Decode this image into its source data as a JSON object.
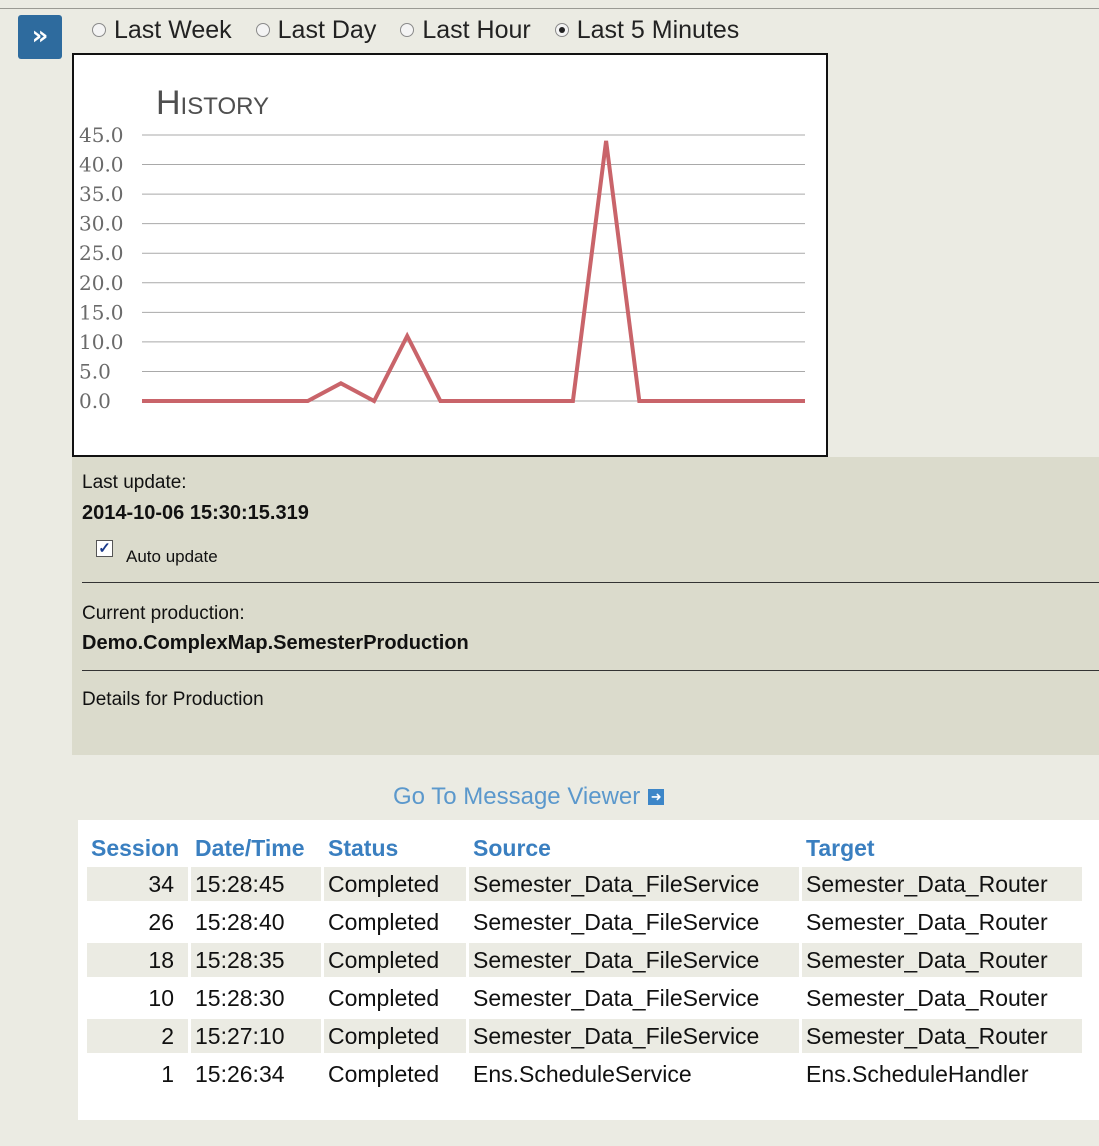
{
  "expand_button": {
    "label": "»"
  },
  "time_range": {
    "options": [
      {
        "label": "Last Week",
        "selected": false
      },
      {
        "label": "Last Day",
        "selected": false
      },
      {
        "label": "Last Hour",
        "selected": false
      },
      {
        "label": "Last 5 Minutes",
        "selected": true
      }
    ]
  },
  "chart_data": {
    "type": "line",
    "title": "History",
    "xlabel": "",
    "ylabel": "",
    "ylim": [
      0,
      45
    ],
    "yticks": [
      "45.0",
      "40.0",
      "35.0",
      "30.0",
      "25.0",
      "20.0",
      "15.0",
      "10.0",
      "5.0",
      "0.0"
    ],
    "grid": true,
    "series": [
      {
        "color": "#c9646a",
        "values": [
          0,
          0,
          0,
          0,
          0,
          0,
          3,
          0,
          11,
          0,
          0,
          0,
          0,
          0,
          44,
          0,
          0,
          0,
          0,
          0,
          0
        ]
      }
    ]
  },
  "status": {
    "last_update_label": "Last update:",
    "last_update_value": "2014-10-06 15:30:15.319",
    "auto_update_label": "Auto update",
    "auto_update_checked": true,
    "current_production_label": "Current production:",
    "current_production_value": "Demo.ComplexMap.SemesterProduction",
    "details_label": "Details for Production"
  },
  "message_viewer_link": "Go To Message Viewer",
  "messages": {
    "columns": [
      "Session",
      "Date/Time",
      "Status",
      "Source",
      "Target"
    ],
    "rows": [
      [
        "34",
        "15:28:45",
        "Completed",
        "Semester_Data_FileService",
        "Semester_Data_Router"
      ],
      [
        "26",
        "15:28:40",
        "Completed",
        "Semester_Data_FileService",
        "Semester_Data_Router"
      ],
      [
        "18",
        "15:28:35",
        "Completed",
        "Semester_Data_FileService",
        "Semester_Data_Router"
      ],
      [
        "10",
        "15:28:30",
        "Completed",
        "Semester_Data_FileService",
        "Semester_Data_Router"
      ],
      [
        "2",
        "15:27:10",
        "Completed",
        "Semester_Data_FileService",
        "Semester_Data_Router"
      ],
      [
        "1",
        "15:26:34",
        "Completed",
        "Ens.ScheduleService",
        "Ens.ScheduleHandler"
      ]
    ]
  }
}
